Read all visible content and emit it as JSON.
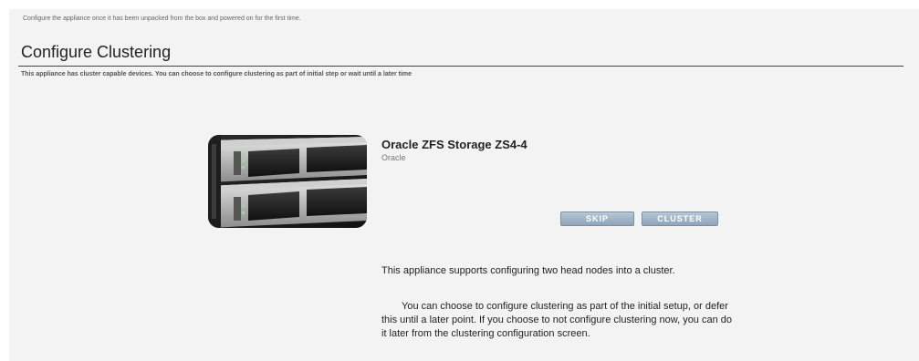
{
  "page": {
    "intro_text": "Configure the appliance once it has been unpacked from the box and powered on for the first time."
  },
  "section": {
    "title": "Configure Clustering",
    "description": "This appliance has cluster capable devices. You can choose to configure clustering as part of initial step or wait until a later time"
  },
  "product": {
    "name": "Oracle ZFS Storage ZS4-4",
    "vendor": "Oracle",
    "image_icon": "storage-server-rack-photo"
  },
  "actions": {
    "skip_label": "SKIP",
    "cluster_label": "CLUSTER"
  },
  "help": {
    "paragraph1": "This appliance supports configuring two head nodes into a cluster.",
    "paragraph2": "You can choose to configure clustering as part of the initial setup, or defer this until a later point. If you choose to not configure clustering now, you can do it later from the clustering configuration screen."
  },
  "colors": {
    "page_background": "#f3f3f3",
    "button_gradient_top": "#b6c7d6",
    "button_gradient_bottom": "#8fa4b8",
    "rule": "#444444"
  }
}
